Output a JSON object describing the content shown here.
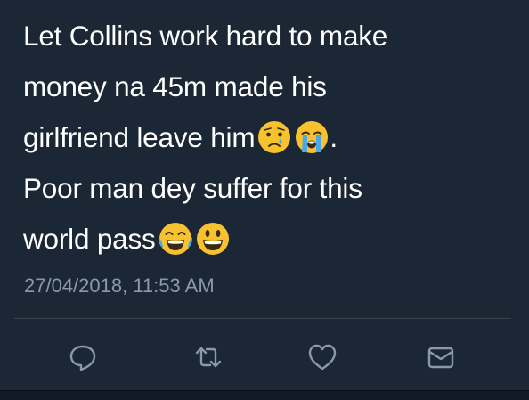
{
  "tweet": {
    "lines": [
      "Let Collins work hard to make",
      "money na 45m made his",
      "girlfriend leave him",
      "Poor man dey suffer for this",
      "world pass"
    ],
    "line3_suffix": ".",
    "timestamp": "27/04/2018, 11:53 AM"
  },
  "emojis": {
    "line3": [
      "crying-face-icon",
      "loudly-crying-face-icon"
    ],
    "line5": [
      "face-with-tears-of-joy-icon",
      "grinning-face-icon"
    ]
  },
  "actions": [
    "reply-icon",
    "retweet-icon",
    "like-icon",
    "direct-message-icon"
  ],
  "colors": {
    "background": "#1b2735",
    "text": "#ffffff",
    "muted": "#8a99a8",
    "icon": "#8a99a8",
    "emoji_yellow": "#f7c22e",
    "tear_blue": "#4aa8e8"
  }
}
